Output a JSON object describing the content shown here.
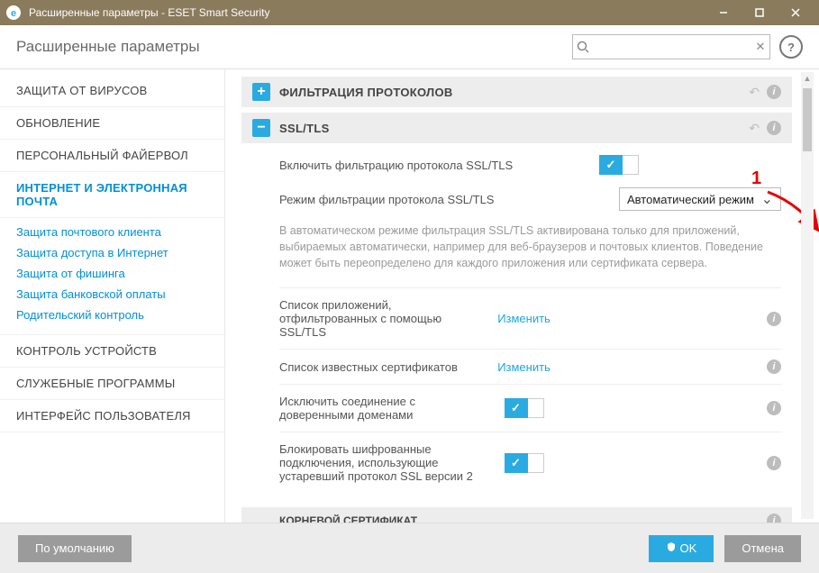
{
  "window": {
    "title": "Расширенные параметры - ESET Smart Security"
  },
  "header": {
    "title": "Расширенные параметры",
    "search_placeholder": ""
  },
  "sidebar": {
    "items": [
      {
        "label": "ЗАЩИТА ОТ ВИРУСОВ"
      },
      {
        "label": "ОБНОВЛЕНИЕ"
      },
      {
        "label": "ПЕРСОНАЛЬНЫЙ ФАЙЕРВОЛ"
      },
      {
        "label": "ИНТЕРНЕТ И ЭЛЕКТРОННАЯ ПОЧТА"
      },
      {
        "label": "КОНТРОЛЬ УСТРОЙСТВ"
      },
      {
        "label": "СЛУЖЕБНЫЕ ПРОГРАММЫ"
      },
      {
        "label": "ИНТЕРФЕЙС ПОЛЬЗОВАТЕЛЯ"
      }
    ],
    "subs": [
      {
        "label": "Защита почтового клиента"
      },
      {
        "label": "Защита доступа в Интернет"
      },
      {
        "label": "Защита от фишинга"
      },
      {
        "label": "Защита банковской оплаты"
      },
      {
        "label": "Родительский контроль"
      }
    ]
  },
  "sections": {
    "protocol_filtering": "ФИЛЬТРАЦИЯ ПРОТОКОЛОВ",
    "ssltls": "SSL/TLS",
    "root_cert": "КОРНЕВОЙ СЕРТИФИКАТ"
  },
  "settings": {
    "enable_ssl": "Включить фильтрацию протокола SSL/TLS",
    "mode_label": "Режим фильтрации протокола SSL/TLS",
    "mode_value": "Автоматический режим",
    "description": "В автоматическом режиме фильтрация SSL/TLS активирована только для приложений, выбираемых автоматически, например для веб-браузеров и почтовых клиентов. Поведение может быть переопределено для каждого приложения или сертификата сервера.",
    "app_list": "Список приложений, отфильтрованных с помощью SSL/TLS",
    "cert_list": "Список известных сертификатов",
    "exclude_trusted": "Исключить соединение с доверенными доменами",
    "block_old_ssl": "Блокировать шифрованные подключения, использующие устаревший протокол SSL версии 2",
    "edit": "Изменить"
  },
  "footer": {
    "default": "По умолчанию",
    "ok": "OK",
    "cancel": "Отмена"
  },
  "annotation": {
    "num": "1"
  }
}
